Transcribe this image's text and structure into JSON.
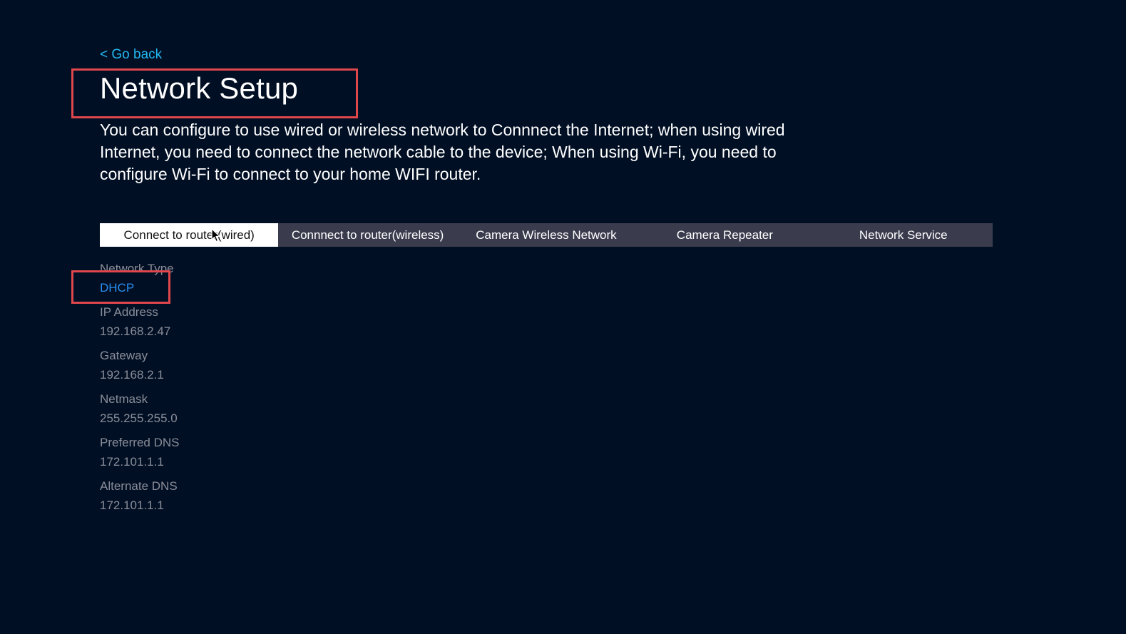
{
  "nav": {
    "back_label": "< Go back"
  },
  "header": {
    "title": "Network Setup",
    "description": "You can configure to use wired or wireless network to Connnect the Internet; when using wired Internet, you need to connect the network cable to the device; When using Wi-Fi, you need to configure Wi-Fi to connect to your home WIFI router."
  },
  "tabs": [
    {
      "label": "Connect to router(wired)",
      "active": true
    },
    {
      "label": "Connnect to router(wireless)",
      "active": false
    },
    {
      "label": "Camera Wireless Network",
      "active": false
    },
    {
      "label": "Camera Repeater",
      "active": false
    },
    {
      "label": "Network Service",
      "active": false
    }
  ],
  "fields": [
    {
      "label": "Network Type",
      "value": "DHCP"
    },
    {
      "label": "IP Address",
      "value": "192.168.2.47"
    },
    {
      "label": "Gateway",
      "value": "192.168.2.1"
    },
    {
      "label": "Netmask",
      "value": "255.255.255.0"
    },
    {
      "label": "Preferred DNS",
      "value": "172.101.1.1"
    },
    {
      "label": "Alternate DNS",
      "value": "172.101.1.1"
    }
  ],
  "colors": {
    "background": "#010f24",
    "link": "#22b8f0",
    "value_link": "#2a8ef0",
    "tab_bar": "#3a3c4e",
    "highlight": "#e0474d",
    "muted_text": "#8a8d98"
  },
  "icons": {
    "cursor": "mouse-pointer-icon"
  }
}
